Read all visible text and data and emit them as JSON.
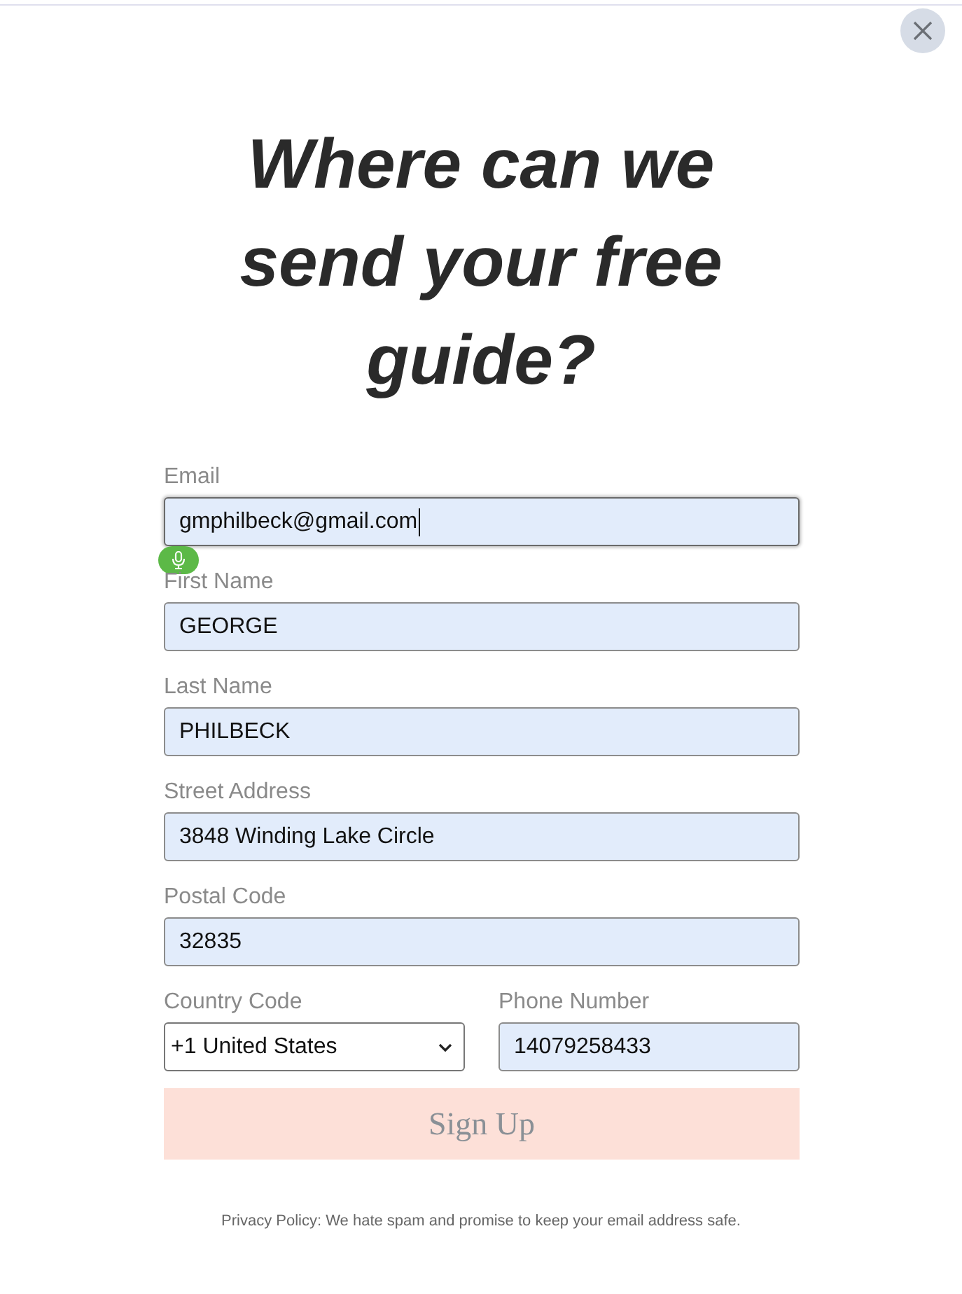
{
  "heading": "Where can we send your free guide?",
  "form": {
    "rows": [
      {
        "fields": [
          {
            "kind": "input",
            "label": "Email",
            "value": "gmphilbeck@gmail.com",
            "autofilled": true,
            "focused": true
          }
        ]
      },
      {
        "fields": [
          {
            "kind": "input",
            "label": "First Name",
            "value": "GEORGE",
            "autofilled": true,
            "focused": false
          }
        ]
      },
      {
        "fields": [
          {
            "kind": "input",
            "label": "Last Name",
            "value": "PHILBECK",
            "autofilled": true,
            "focused": false
          }
        ]
      },
      {
        "fields": [
          {
            "kind": "input",
            "label": "Street Address",
            "value": "3848 Winding Lake Circle",
            "autofilled": true,
            "focused": false
          }
        ]
      },
      {
        "fields": [
          {
            "kind": "input",
            "label": "Postal Code",
            "value": "32835",
            "autofilled": true,
            "focused": false
          }
        ]
      },
      {
        "fields": [
          {
            "kind": "select",
            "label": "Country Code",
            "value": "+1 United States",
            "autofilled": false,
            "focused": false
          },
          {
            "kind": "input",
            "label": "Phone Number",
            "value": "14079258433",
            "autofilled": true,
            "focused": false
          }
        ]
      }
    ]
  },
  "submit_button": {
    "label": "Sign Up"
  },
  "privacy_note": "Privacy Policy: We hate spam and promise to keep your email address safe."
}
